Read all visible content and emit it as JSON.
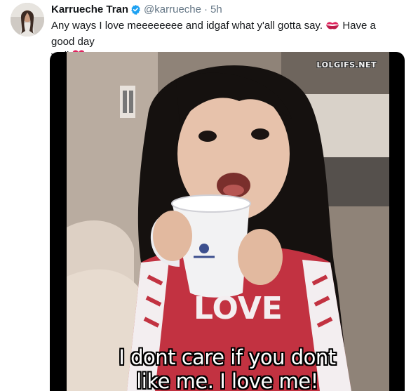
{
  "tweet": {
    "author_name": "Karrueche Tran",
    "handle": "@karrueche",
    "separator": "·",
    "time": "5h",
    "text_line1": "Any ways I love meeeeeeee and idgaf what y'all gotta say.",
    "text_after_kiss": "Have a good day",
    "text_line2": "y'all",
    "emojis": [
      "kiss-mark-icon",
      "red-heart-icon"
    ]
  },
  "media": {
    "watermark": "LOLGIFS.NET",
    "caption_line1": "I dont care if you dont",
    "caption_line2": "like me. I love me!",
    "mug_text": "LOVE"
  },
  "colors": {
    "name": "#14171a",
    "secondary": "#657786",
    "verified": "#1da1f2",
    "heart": "#e0245e"
  }
}
